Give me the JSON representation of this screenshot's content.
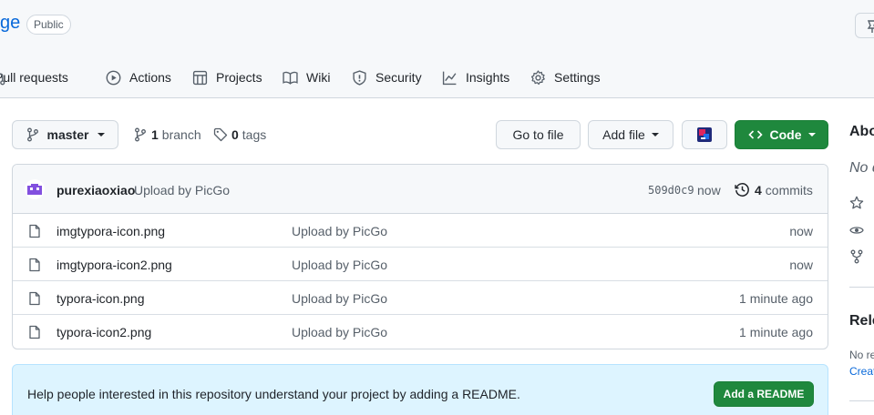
{
  "repo": {
    "name_fragment": "ge",
    "visibility": "Public"
  },
  "nav": {
    "items": [
      {
        "label": "Pull requests",
        "icon": "pull-request-icon"
      },
      {
        "label": "Actions",
        "icon": "play-icon"
      },
      {
        "label": "Projects",
        "icon": "table-icon"
      },
      {
        "label": "Wiki",
        "icon": "book-icon"
      },
      {
        "label": "Security",
        "icon": "shield-icon"
      },
      {
        "label": "Insights",
        "icon": "graph-icon"
      },
      {
        "label": "Settings",
        "icon": "gear-icon"
      }
    ]
  },
  "toolbar": {
    "branch": "master",
    "branch_count": "1",
    "branch_label": "branch",
    "tag_count": "0",
    "tag_label": "tags",
    "go_to_file": "Go to file",
    "add_file": "Add file",
    "code": "Code"
  },
  "latest_commit": {
    "author": "purexiaoxiao",
    "message": "Upload by PicGo",
    "sha": "509d0c9",
    "time": "now",
    "commit_count": "4",
    "commit_label": "commits"
  },
  "files": [
    {
      "name": "imgtypora-icon.png",
      "message": "Upload by PicGo",
      "time": "now"
    },
    {
      "name": "imgtypora-icon2.png",
      "message": "Upload by PicGo",
      "time": "now"
    },
    {
      "name": "typora-icon.png",
      "message": "Upload by PicGo",
      "time": "1 minute ago"
    },
    {
      "name": "typora-icon2.png",
      "message": "Upload by PicGo",
      "time": "1 minute ago"
    }
  ],
  "readme": {
    "text": "Help people interested in this repository understand your project by adding a README.",
    "button": "Add a README"
  },
  "sidebar": {
    "about_fragment": "Abo",
    "description_fragment": "No d",
    "releases_fragment": "Rele",
    "no_releases_fragment": "No re",
    "create_link_fragment": "Creat"
  },
  "colors": {
    "accent": "#0969da",
    "green": "#1f883d",
    "readme_bg": "#ddf4ff"
  }
}
